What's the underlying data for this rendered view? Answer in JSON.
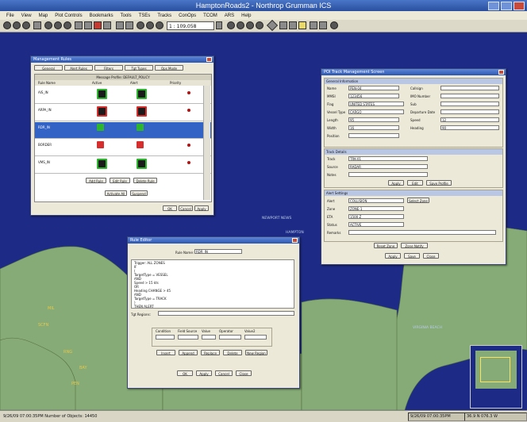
{
  "window": {
    "title": "HamptonRoads2 - Northrop Grumman ICS"
  },
  "menu": [
    "File",
    "View",
    "Map",
    "Plot Controls",
    "Bookmarks",
    "Tools",
    "TSEs",
    "Tracks",
    "ConOps",
    "TCOM",
    "ARS",
    "Help"
  ],
  "toolbar": {
    "zoom_value": "1 : 109,058"
  },
  "map": {
    "labels": [
      "NEWPORT NEWS",
      "HAMPTON",
      "NORFOLK",
      "PORTSMOUTH",
      "VIRGINIA BEACH"
    ],
    "highlight_labels": [
      "MIL",
      "SCFN",
      "RNG",
      "BAY",
      "PEN"
    ]
  },
  "status": {
    "left": "9/26/09 07:00:35PM Number of Objects: 14450",
    "right1": "9/26/09 07:00:35PM",
    "right2": "36.9 N 076.3 W"
  },
  "dlg1": {
    "title": "Management Rules",
    "tabs": [
      "General",
      "Alert Rules",
      "Filters",
      "Tgt Types",
      "Ops Mode"
    ],
    "grid_title": "Message Profile: DEFAULT_POLICY",
    "columns": [
      "Rule Name",
      "Active",
      "Alert",
      "Priority"
    ],
    "rows": [
      "AIS_IN",
      "ARPA_IN",
      "RDR_IN",
      "BORDER",
      "VMS_IN"
    ],
    "row_buttons": [
      "Add Rule",
      "Edit Rule",
      "Delete Rule"
    ],
    "buttons": [
      "Activate All",
      "Suspend"
    ],
    "footer": [
      "OK",
      "Cancel",
      "Apply"
    ]
  },
  "dlg2": {
    "title": "Rule Editor",
    "rule_name_label": "Rule Name:",
    "rule_name_value": "RDR_IN",
    "script_lines": [
      "Trigger: ALL ZONES",
      "IF",
      "  (",
      "   TargetType = VESSEL",
      "   AND",
      "   Speed > 15 kts",
      "   OR",
      "   Heading CHANGE > 45",
      "   AND",
      "   TargetType = TRACK",
      "  )",
      "THEN ALERT"
    ],
    "tgt_regions_label": "Tgt Regions:",
    "columns": [
      "Condition",
      "Field Source",
      "Value",
      "Operator",
      "Value2"
    ],
    "ops_buttons": [
      "Insert",
      "Append",
      "Replace",
      "Delete",
      "New Region"
    ],
    "footer": [
      "OK",
      "Apply",
      "Cancel",
      "Close"
    ]
  },
  "dlg3": {
    "title": "POI Track Management Screen",
    "sec1": "General Information",
    "sec2": "Track Details",
    "sec3": "Alert Settings",
    "fields": [
      [
        "Name",
        "PEN-04"
      ],
      [
        "MMSI",
        "123456"
      ],
      [
        "Flag",
        "UNITED STATES"
      ],
      [
        "Vessel Type",
        "CARGO"
      ],
      [
        "Length",
        "95"
      ],
      [
        "Width",
        "16"
      ],
      [
        "Position",
        ""
      ]
    ],
    "fields_right": [
      [
        "Callsign",
        ""
      ],
      [
        "IMO Number",
        ""
      ],
      [
        "Sub",
        ""
      ],
      [
        "Departure Date",
        ""
      ],
      [
        "Speed",
        "12"
      ],
      [
        "Heading",
        "90"
      ]
    ],
    "track_fields": [
      [
        "Track",
        "TRK-01"
      ],
      [
        "Source",
        "RADAR"
      ],
      [
        "Notes",
        ""
      ]
    ],
    "track_buttons": [
      "Apply",
      "Edit",
      "Save Profile"
    ],
    "alert_fields": [
      [
        "Alert",
        "COLLISION"
      ],
      [
        "Zone",
        "ZONE-1"
      ],
      [
        "ETA",
        "1500 Z"
      ],
      [
        "Status",
        "ACTIVE"
      ],
      [
        "Remarks",
        ""
      ]
    ],
    "alert_buttons": [
      "Select Zone",
      "Reset Zone",
      "Zone Notify"
    ],
    "footer": [
      "Apply",
      "Save",
      "Close"
    ]
  }
}
